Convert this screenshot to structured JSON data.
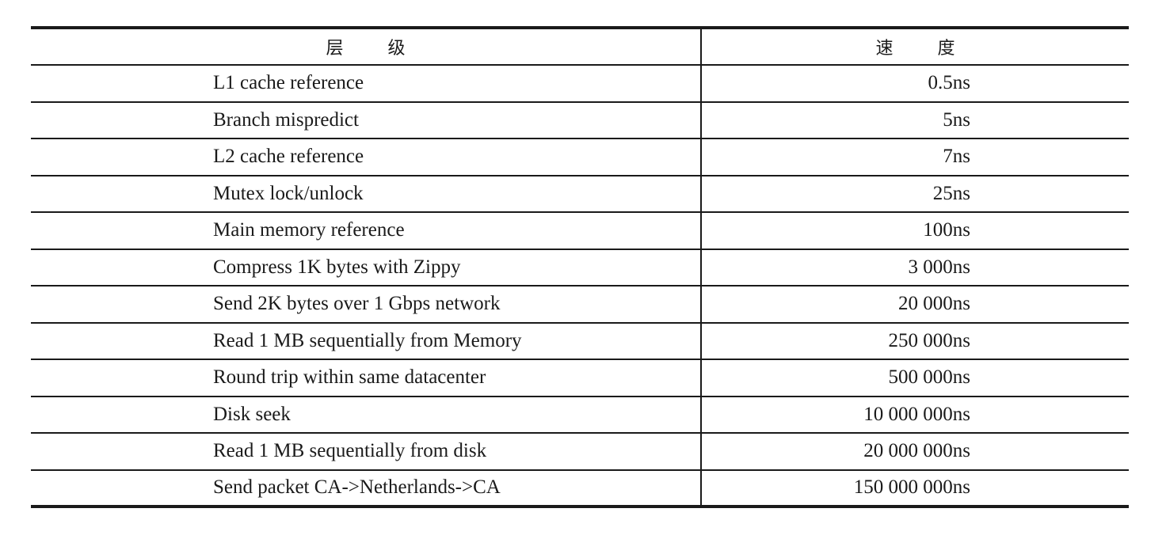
{
  "table": {
    "header": {
      "level_chars": [
        "层",
        "级"
      ],
      "speed_chars": [
        "速",
        "度"
      ]
    },
    "rows": [
      {
        "level": "L1 cache reference",
        "speed": "0.5ns"
      },
      {
        "level": "Branch mispredict",
        "speed": "5ns"
      },
      {
        "level": "L2 cache reference",
        "speed": "7ns"
      },
      {
        "level": "Mutex lock/unlock",
        "speed": "25ns"
      },
      {
        "level": "Main memory reference",
        "speed": "100ns"
      },
      {
        "level": "Compress 1K bytes with Zippy",
        "speed": "3 000ns"
      },
      {
        "level": "Send 2K bytes over 1 Gbps network",
        "speed": "20 000ns"
      },
      {
        "level": "Read 1 MB sequentially from Memory",
        "speed": "250 000ns"
      },
      {
        "level": "Round trip within same datacenter",
        "speed": "500 000ns"
      },
      {
        "level": "Disk seek",
        "speed": "10 000 000ns"
      },
      {
        "level": "Read 1 MB sequentially from disk",
        "speed": "20 000 000ns"
      },
      {
        "level": "Send packet CA->Netherlands->CA",
        "speed": "150 000 000ns"
      }
    ]
  }
}
